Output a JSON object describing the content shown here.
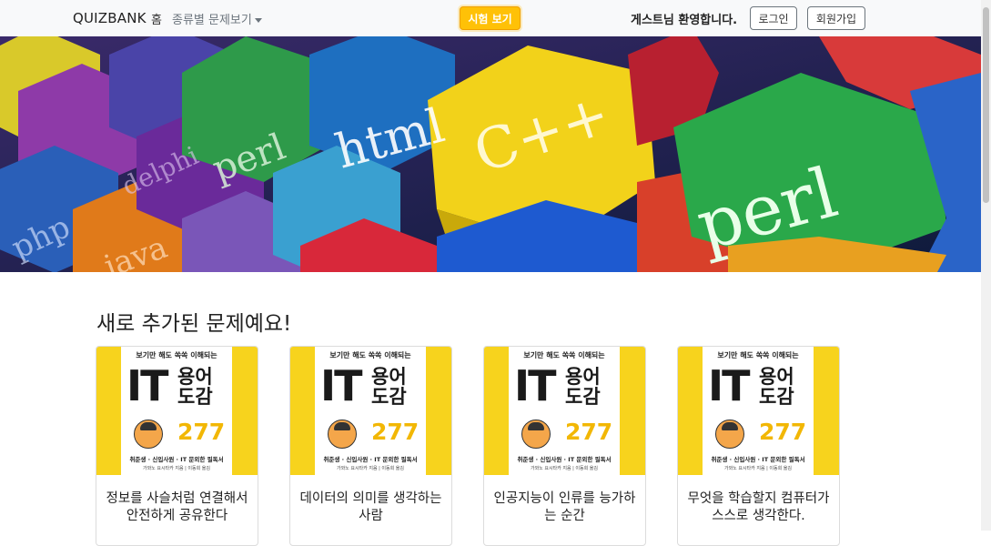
{
  "navbar": {
    "brand": "QUIZBANK",
    "home": "홈",
    "category_dropdown": "종류별 문제보기",
    "exam_button": "시험 보기",
    "welcome": "게스트님 환영합니다.",
    "login": "로그인",
    "signup": "회원가입"
  },
  "hero": {
    "hex_labels": [
      "perl",
      "html",
      "C++",
      "perl",
      "php",
      "java",
      "delphi"
    ]
  },
  "section": {
    "title": "새로 추가된 문제예요!"
  },
  "book": {
    "top_text": "보기만 해도 쏙쏙 이해되는",
    "big": "IT",
    "side1": "용어",
    "side2": "도감",
    "number": "277",
    "subtitle": "취준생 · 신입사원 · IT 문외한 필독서",
    "author": "가와노 요시타카 지음 | 이동희 옮김"
  },
  "cards": [
    {
      "title": "정보를 사슬처럼 연결해서 안전하게 공유한다"
    },
    {
      "title": "데이터의 의미를 생각하는 사람"
    },
    {
      "title": "인공지능이 인류를 능가하는 순간"
    },
    {
      "title": "무엇을 학습할지 컴퓨터가 스스로 생각한다."
    }
  ]
}
